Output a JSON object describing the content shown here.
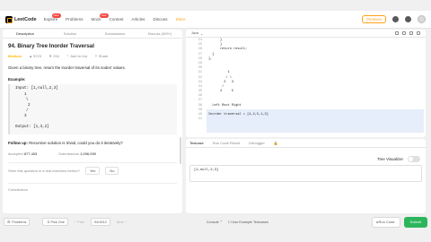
{
  "nav": {
    "logo": "LeetCode",
    "items": [
      {
        "label": "Explore",
        "badge": "New"
      },
      {
        "label": "Problems",
        "badge": ""
      },
      {
        "label": "Mock",
        "badge": "New"
      },
      {
        "label": "Contest",
        "badge": ""
      },
      {
        "label": "Articles",
        "badge": ""
      },
      {
        "label": "Discuss",
        "badge": ""
      }
    ],
    "store": "Store",
    "premium": "Premium"
  },
  "left_tabs": [
    "Description",
    "Solution",
    "Submissions",
    "Discuss (999+)"
  ],
  "problem": {
    "title": "94. Binary Tree Inorder Traversal",
    "difficulty": "Medium",
    "likes": "5723",
    "dislikes": "216",
    "add_to_list": "Add to List",
    "share": "Share",
    "description": "Given a binary tree, return the inorder traversal of its nodes' values.",
    "example_heading": "Example:",
    "example_input": "Input: [1,null,2,3]",
    "example_tree": [
      "1",
      "\\",
      "2",
      "/",
      "3"
    ],
    "example_output": "Output: [1,3,2]",
    "followup_bold": "Follow up:",
    "followup_text": "Recursive solution is trivial, could you do it iteratively?",
    "accepted_label": "Accepted",
    "accepted_value": "677,403",
    "submissions_label": "Submissions",
    "submissions_value": "1,096,939",
    "interview_question": "Seen this question in a real interview before?",
    "yes": "Yes",
    "no": "No",
    "contributors": "Contributors"
  },
  "code": {
    "language": "Java",
    "line_numbers": [
      "24",
      "25",
      "26",
      "27",
      "28",
      "29",
      "30",
      "31",
      "32",
      "33",
      "34",
      "35",
      "36",
      "37",
      "38",
      "39",
      "40",
      "41"
    ],
    "lines": [
      "      }",
      "      }",
      "      return result;",
      "  }",
      "},",
      "",
      "",
      "          1",
      "         / \\",
      "        2   3",
      "       /",
      "      4     5",
      "",
      "",
      "  Left Root Right",
      "",
      "Inorder traversal = [4,2,5,1,3]",
      ""
    ]
  },
  "tests": {
    "tabs": [
      "Testcase",
      "Run Code Result",
      "Debugger"
    ],
    "tree_visualizer": "Tree Visualizer",
    "testcase": "[1,null,2,3]"
  },
  "bottom": {
    "problems": "Problems",
    "pick_one": "Pick One",
    "prev": "Prev",
    "page": "94/1612",
    "next": "Next",
    "console": "Console",
    "use_example": "Use Example Testcases",
    "run": "Run Code",
    "submit": "Submit"
  }
}
